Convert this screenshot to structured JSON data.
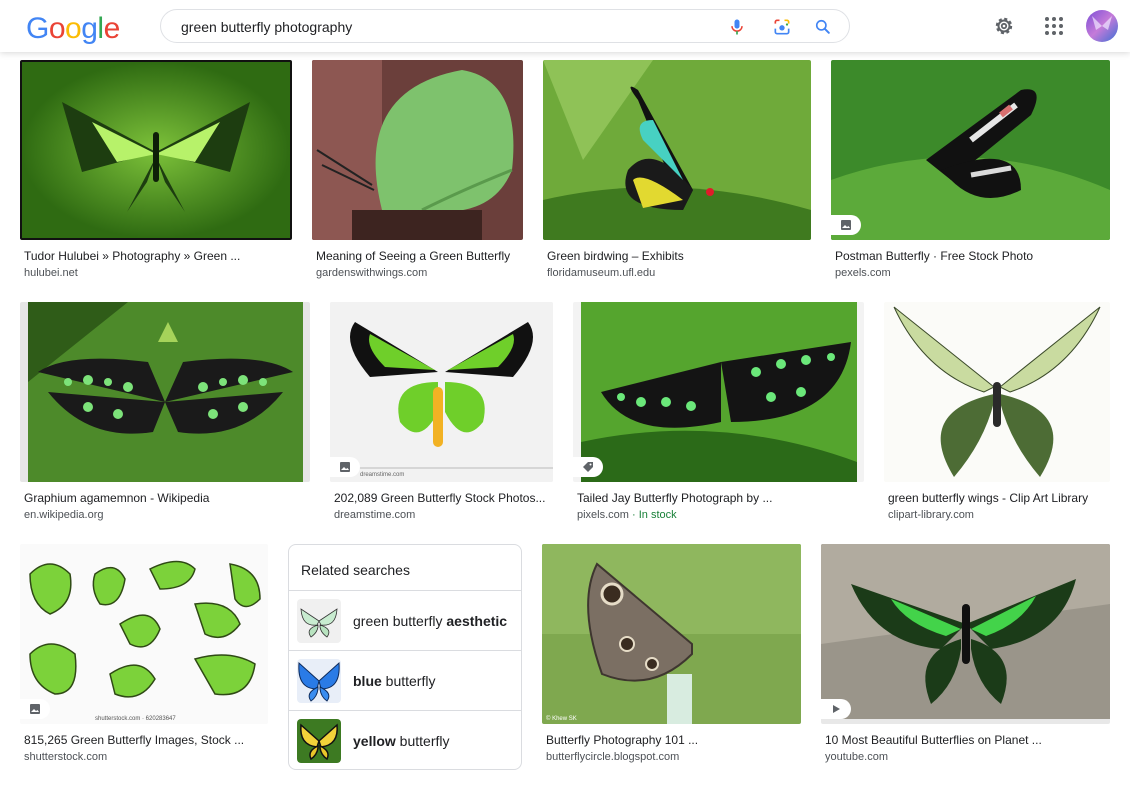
{
  "header": {
    "logo_letters": [
      {
        "char": "G",
        "color": "#4285F4"
      },
      {
        "char": "o",
        "color": "#EA4335"
      },
      {
        "char": "o",
        "color": "#FBBC05"
      },
      {
        "char": "g",
        "color": "#4285F4"
      },
      {
        "char": "l",
        "color": "#34A853"
      },
      {
        "char": "e",
        "color": "#EA4335"
      }
    ],
    "search_query": "green butterfly photography",
    "icons": [
      "microphone-icon",
      "camera-lens-icon",
      "search-icon",
      "gear-icon",
      "apps-grid-icon",
      "avatar"
    ]
  },
  "results": [
    {
      "title": "Tudor Hulubei » Photography » Green ...",
      "source": "hulubei.net",
      "badge": ""
    },
    {
      "title": "Meaning of Seeing a Green Butterfly",
      "source": "gardenswithwings.com",
      "badge": ""
    },
    {
      "title": "Green birdwing – Exhibits",
      "source": "floridamuseum.ufl.edu",
      "badge": ""
    },
    {
      "title": "Postman Butterfly · Free Stock Photo",
      "source": "pexels.com",
      "badge": "image-icon"
    },
    {
      "title": "Graphium agamemnon - Wikipedia",
      "source": "en.wikipedia.org",
      "badge": ""
    },
    {
      "title": "202,089 Green Butterfly Stock Photos...",
      "source": "dreamstime.com",
      "badge": "image-icon",
      "overlay_text": "dreamstime.com"
    },
    {
      "title": "Tailed Jay Butterfly Photograph by ...",
      "source": "pixels.com",
      "extra": "In stock",
      "badge": "tag-icon"
    },
    {
      "title": "green butterfly wings - Clip Art Library",
      "source": "clipart-library.com",
      "badge": ""
    },
    {
      "title": "815,265 Green Butterfly Images, Stock ...",
      "source": "shutterstock.com",
      "badge": "image-icon",
      "overlay_text": "shutterstock.com · 620283647"
    },
    {
      "title": "Butterfly Photography 101 ...",
      "source": "butterflycircle.blogspot.com",
      "badge": "",
      "overlay_text": "© Khew SK"
    },
    {
      "title": "10 Most Beautiful Butterflies on Planet ...",
      "source": "youtube.com",
      "badge": "play-icon"
    }
  ],
  "related_searches": {
    "title": "Related searches",
    "items": [
      {
        "pre": "green butterfly ",
        "bold": "aesthetic",
        "post": ""
      },
      {
        "pre": "",
        "bold": "blue",
        "post": " butterfly"
      },
      {
        "pre": "",
        "bold": "yellow",
        "post": " butterfly"
      }
    ]
  },
  "colors": {
    "title": "#202124",
    "source": "#4d5156",
    "in_stock": "#188038",
    "border": "#dadce0"
  }
}
